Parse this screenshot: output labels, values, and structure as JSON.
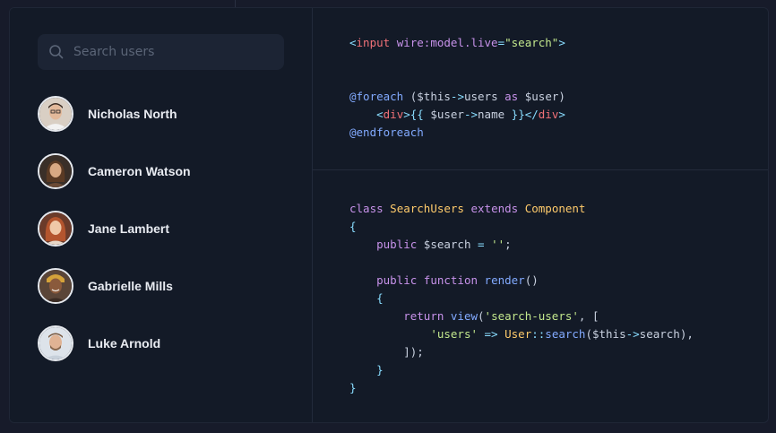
{
  "search": {
    "placeholder": "Search users"
  },
  "users": [
    {
      "name": "Nicholas North",
      "avatar_bg": "#d9cfc4"
    },
    {
      "name": "Cameron Watson",
      "avatar_bg": "#3a2f28"
    },
    {
      "name": "Jane Lambert",
      "avatar_bg": "#6b3b2a"
    },
    {
      "name": "Gabrielle Mills",
      "avatar_bg": "#5a4538"
    },
    {
      "name": "Luke Arnold",
      "avatar_bg": "#dde3ea"
    }
  ],
  "code_blade": [
    "<input wire:model.live=\"search\">",
    "",
    "",
    "@foreach ($this->users as $user)",
    "    <div>{{ $user->name }}</div>",
    "@endforeach"
  ],
  "code_php": [
    "class SearchUsers extends Component",
    "{",
    "    public $search = '';",
    "",
    "    public function render()",
    "    {",
    "        return view('search-users', [",
    "            'users' => User::search($this->search),",
    "        ]);",
    "    }",
    "}"
  ],
  "colors": {
    "background": "#131a27",
    "search_bg": "#1c2434",
    "tag": "#f07178",
    "keyword": "#c792ea",
    "string": "#c3e88d",
    "class": "#ffcb6b",
    "function": "#82aaff"
  }
}
